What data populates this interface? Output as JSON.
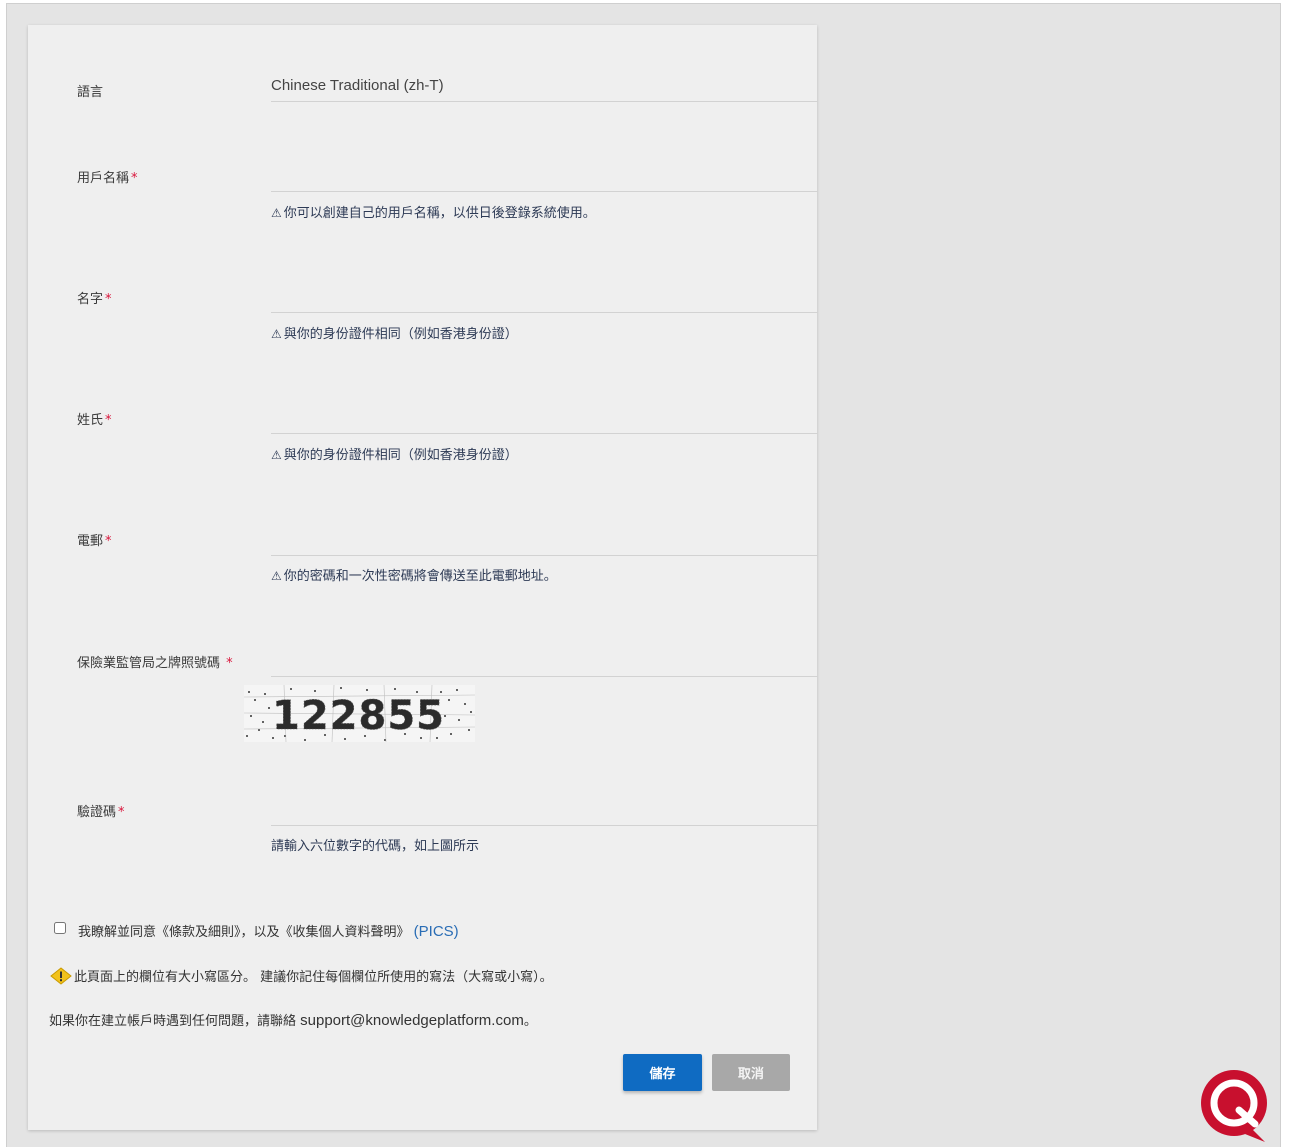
{
  "form": {
    "language": {
      "label": "語言",
      "value": "Chinese Traditional (zh-T)"
    },
    "username": {
      "label": "用戶名稱",
      "required_mark": "*",
      "value": "",
      "hint_icon": "⚠",
      "hint": "你可以創建自己的用戶名稱，以供日後登錄系統使用。"
    },
    "first_name": {
      "label": "名字",
      "required_mark": "*",
      "value": "",
      "hint_icon": "⚠",
      "hint": "與你的身份證件相同（例如香港身份證）"
    },
    "last_name": {
      "label": "姓氏",
      "required_mark": "*",
      "value": "",
      "hint_icon": "⚠",
      "hint": "與你的身份證件相同（例如香港身份證）"
    },
    "email": {
      "label": "電郵",
      "required_mark": "*",
      "value": "",
      "hint_icon": "⚠",
      "hint": "你的密碼和一次性密碼將會傳送至此電郵地址。"
    },
    "license": {
      "label": "保險業監管局之牌照號碼",
      "required_mark": " *",
      "value": ""
    },
    "captcha": {
      "image_text": "122855",
      "label": "驗證碼",
      "required_mark": "*",
      "value": "",
      "hint": "請輸入六位數字的代碼，如上圖所示"
    }
  },
  "agreement": {
    "checked": false,
    "text": "我瞭解並同意《條款及細則》，以及《收集個人資料聲明》",
    "link": "(PICS)"
  },
  "case_note": {
    "icon": "warning-diamond-icon",
    "text": "此頁面上的欄位有大小寫區分。 建議你記住每個欄位所使用的寫法（大寫或小寫）。"
  },
  "support_note": {
    "prefix": "如果你在建立帳戶時遇到任何問題，請聯絡 ",
    "email": "support@knowledgeplatform.com",
    "suffix": "。"
  },
  "buttons": {
    "save": "儲存",
    "cancel": "取消"
  },
  "colors": {
    "primary": "#0f6bc2",
    "cancel": "#a8a8a8",
    "required": "#d9143a",
    "chat": "#c8102e"
  },
  "chat": {
    "icon": "chat-bubble-icon"
  }
}
